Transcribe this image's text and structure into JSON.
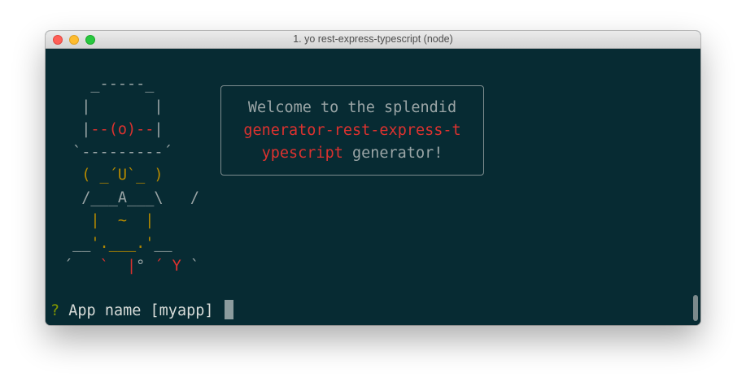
{
  "window": {
    "title": "1. yo rest-express-typescript (node)"
  },
  "art": {
    "lines": [
      [
        {
          "t": "   _-----_",
          "c": "gray"
        }
      ],
      [
        {
          "t": "  |       |",
          "c": "gray"
        }
      ],
      [
        {
          "t": "  |",
          "c": "gray"
        },
        {
          "t": "--(o)--",
          "c": "red"
        },
        {
          "t": "|",
          "c": "gray"
        }
      ],
      [
        {
          "t": " `---------´",
          "c": "gray"
        }
      ],
      [
        {
          "t": "  ( _´U`_ )",
          "c": "yellow"
        }
      ],
      [
        {
          "t": "  /___A___\\   /",
          "c": "gray"
        }
      ],
      [
        {
          "t": "   |  ~  |",
          "c": "yellow"
        }
      ],
      [
        {
          "t": " __",
          "c": "gray"
        },
        {
          "t": "'.___.'",
          "c": "yellow"
        },
        {
          "t": "__",
          "c": "gray"
        }
      ],
      [
        {
          "t": "´   ",
          "c": "gray"
        },
        {
          "t": "`  |",
          "c": "red"
        },
        {
          "t": "° ",
          "c": "gray"
        },
        {
          "t": "´ Y",
          "c": "red"
        },
        {
          "t": " `",
          "c": "gray"
        }
      ]
    ]
  },
  "welcome": {
    "lines": [
      [
        {
          "t": "Welcome to the splendid",
          "c": "gray"
        }
      ],
      [
        {
          "t": "generator-rest-express-t",
          "c": "red"
        }
      ],
      [
        {
          "t": "ypescript",
          "c": "red"
        },
        {
          "t": " generator!",
          "c": "gray"
        }
      ]
    ]
  },
  "prompt": {
    "mark": "?",
    "label": "App name",
    "default": "[myapp]"
  },
  "colors": {
    "background": "#072b33",
    "red": "#dc322f",
    "yellow": "#b58900",
    "green": "#859900",
    "gray": "#9aa5a6"
  }
}
